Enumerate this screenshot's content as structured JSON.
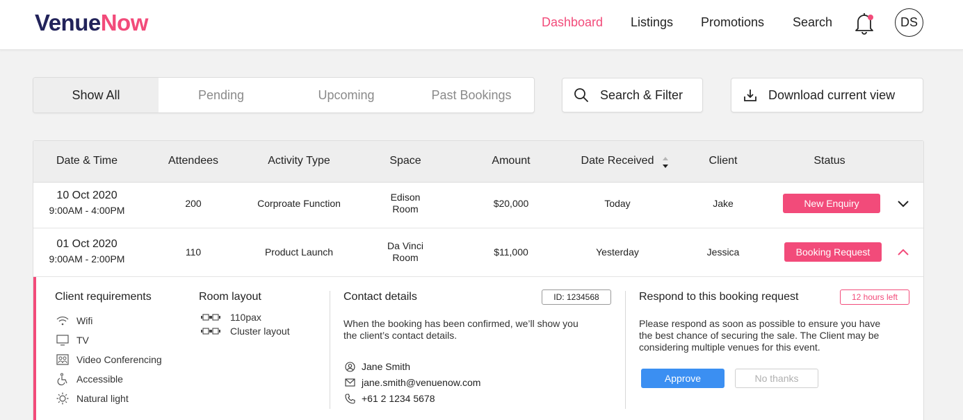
{
  "brand": {
    "part1": "Venue",
    "part2": "Now"
  },
  "nav": {
    "items": [
      "Dashboard",
      "Listings",
      "Promotions",
      "Search"
    ],
    "active": "Dashboard",
    "notification_icon": "bell-icon",
    "avatar_initials": "DS"
  },
  "filters": {
    "tabs": [
      "Show All",
      "Pending",
      "Upcoming",
      "Past Bookings"
    ],
    "active_tab": "Show All",
    "search_label": "Search & Filter",
    "download_label": "Download current view"
  },
  "table": {
    "headers": [
      "Date & Time",
      "Attendees",
      "Activity Type",
      "Space",
      "Amount",
      "Date Received",
      "Client",
      "Status"
    ],
    "sort_column": "Date Received",
    "rows": [
      {
        "date": "10 Oct 2020",
        "time": "9:00AM - 4:00PM",
        "attendees": "200",
        "activity": "Corproate Function",
        "space_line1": "Edison",
        "space_line2": "Room",
        "amount": "$20,000",
        "received": "Today",
        "client": "Jake",
        "status": "New Enquiry",
        "expanded": false
      },
      {
        "date": "01 Oct 2020",
        "time": "9:00AM - 2:00PM",
        "attendees": "110",
        "activity": "Product Launch",
        "space_line1": "Da Vinci",
        "space_line2": "Room",
        "amount": "$11,000",
        "received": "Yesterday",
        "client": "Jessica",
        "status": "Booking Request",
        "expanded": true
      }
    ]
  },
  "details": {
    "requirements_title": "Client requirements",
    "requirements": [
      {
        "label": "Wifi",
        "icon": "wifi-icon"
      },
      {
        "label": "TV",
        "icon": "tv-icon"
      },
      {
        "label": "Video Conferencing",
        "icon": "video-conferencing-icon"
      },
      {
        "label": "Accessible",
        "icon": "wheelchair-icon"
      },
      {
        "label": "Natural light",
        "icon": "sun-icon"
      }
    ],
    "layout_title": "Room layout",
    "layout": [
      {
        "label": "110pax",
        "icon": "cluster-layout-icon"
      },
      {
        "label": "Cluster layout",
        "icon": "cluster-layout-icon"
      }
    ],
    "contact_title": "Contact details",
    "booking_id": "ID: 1234568",
    "contact_note_line1": "When the booking has been confirmed, we’ll show you",
    "contact_note_line2": "the client’s contact details.",
    "contact_name": "Jane Smith",
    "contact_email": "jane.smith@venuenow.com",
    "contact_phone": "+61 2 1234 5678",
    "respond_title": "Respond to this booking request",
    "time_left": "12 hours left",
    "respond_line1": "Please respond as soon as possible to ensure you have",
    "respond_line2": "the best chance of securing the sale. The Client may be",
    "respond_line3": "considering multiple venues for this event.",
    "approve_label": "Approve",
    "decline_label": "No thanks"
  },
  "colors": {
    "brand_navy": "#22235a",
    "brand_pink": "#f24b7a",
    "approve_blue": "#3b8ff2"
  }
}
